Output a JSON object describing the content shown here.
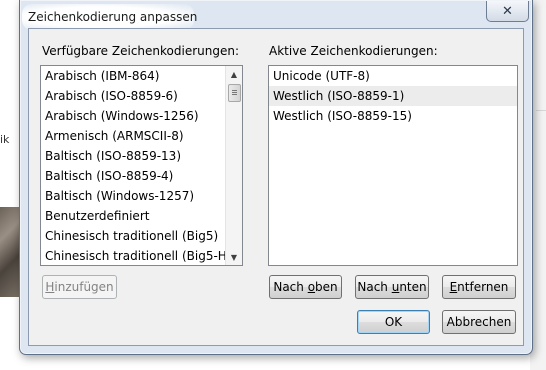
{
  "background": {
    "left_text": "ik"
  },
  "dialog": {
    "title": "Zeichenkodierung anpassen",
    "close_glyph": "✕",
    "available": {
      "label": "Verfügbare Zeichenkodierungen:",
      "items": [
        "Arabisch (IBM-864)",
        "Arabisch (ISO-8859-6)",
        "Arabisch (Windows-1256)",
        "Armenisch (ARMSCII-8)",
        "Baltisch (ISO-8859-13)",
        "Baltisch (ISO-8859-4)",
        "Baltisch (Windows-1257)",
        "Benutzerdefiniert",
        "Chinesisch traditionell (Big5)",
        "Chinesisch traditionell (Big5-H..."
      ],
      "scroll_up_glyph": "▲",
      "scroll_down_glyph": "▼"
    },
    "active": {
      "label": "Aktive Zeichenkodierungen:",
      "items": [
        "Unicode (UTF-8)",
        "Westlich (ISO-8859-1)",
        "Westlich (ISO-8859-15)"
      ],
      "selected_index": 1
    },
    "buttons": {
      "add": {
        "mnemonic": "H",
        "rest": "inzufügen"
      },
      "move_up": {
        "before": "Nach ",
        "mnemonic": "o",
        "rest": "ben"
      },
      "move_down": {
        "before": "Nach ",
        "mnemonic": "u",
        "rest": "nten"
      },
      "remove": {
        "mnemonic": "E",
        "rest": "ntfernen"
      },
      "ok": "OK",
      "cancel": "Abbrechen"
    }
  }
}
